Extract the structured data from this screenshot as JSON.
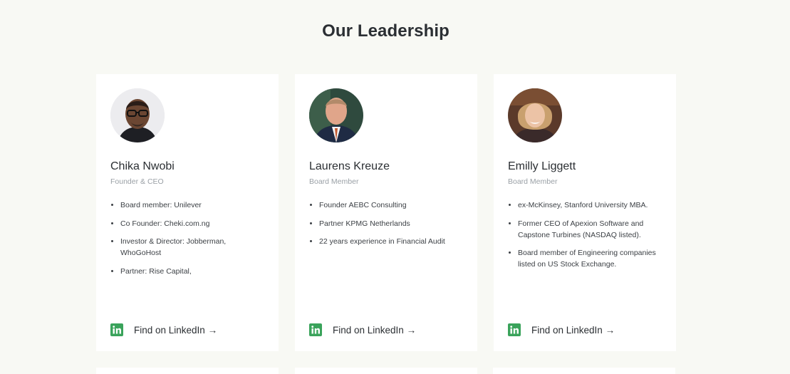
{
  "section": {
    "title": "Our Leadership"
  },
  "leaders": [
    {
      "name": "Chika Nwobi",
      "role": "Founder & CEO",
      "bullets": [
        "Board member: Unilever",
        "Co Founder: Cheki.com.ng",
        "Investor & Director: Jobberman, WhoGoHost",
        "Partner: Rise Capital,"
      ],
      "link_label": "Find on LinkedIn →"
    },
    {
      "name": "Laurens Kreuze",
      "role": "Board Member",
      "bullets": [
        "Founder AEBC Consulting",
        "Partner KPMG Netherlands",
        "22 years experience in Financial Audit"
      ],
      "link_label": "Find on LinkedIn →"
    },
    {
      "name": "Emilly Liggett",
      "role": "Board Member",
      "bullets": [
        "ex-McKinsey, Stanford University MBA.",
        "Former CEO of Apexion Software and Capstone Turbines (NASDAQ listed).",
        "Board member of Engineering companies listed on US Stock Exchange."
      ],
      "link_label": "Find on LinkedIn →"
    }
  ],
  "icons": {
    "linkedin": "linkedin-icon"
  },
  "colors": {
    "background": "#f8f9f4",
    "card": "#ffffff",
    "linkedin_green": "#3aa35b",
    "heading": "#2b2f33",
    "muted": "#9aa0a6"
  }
}
